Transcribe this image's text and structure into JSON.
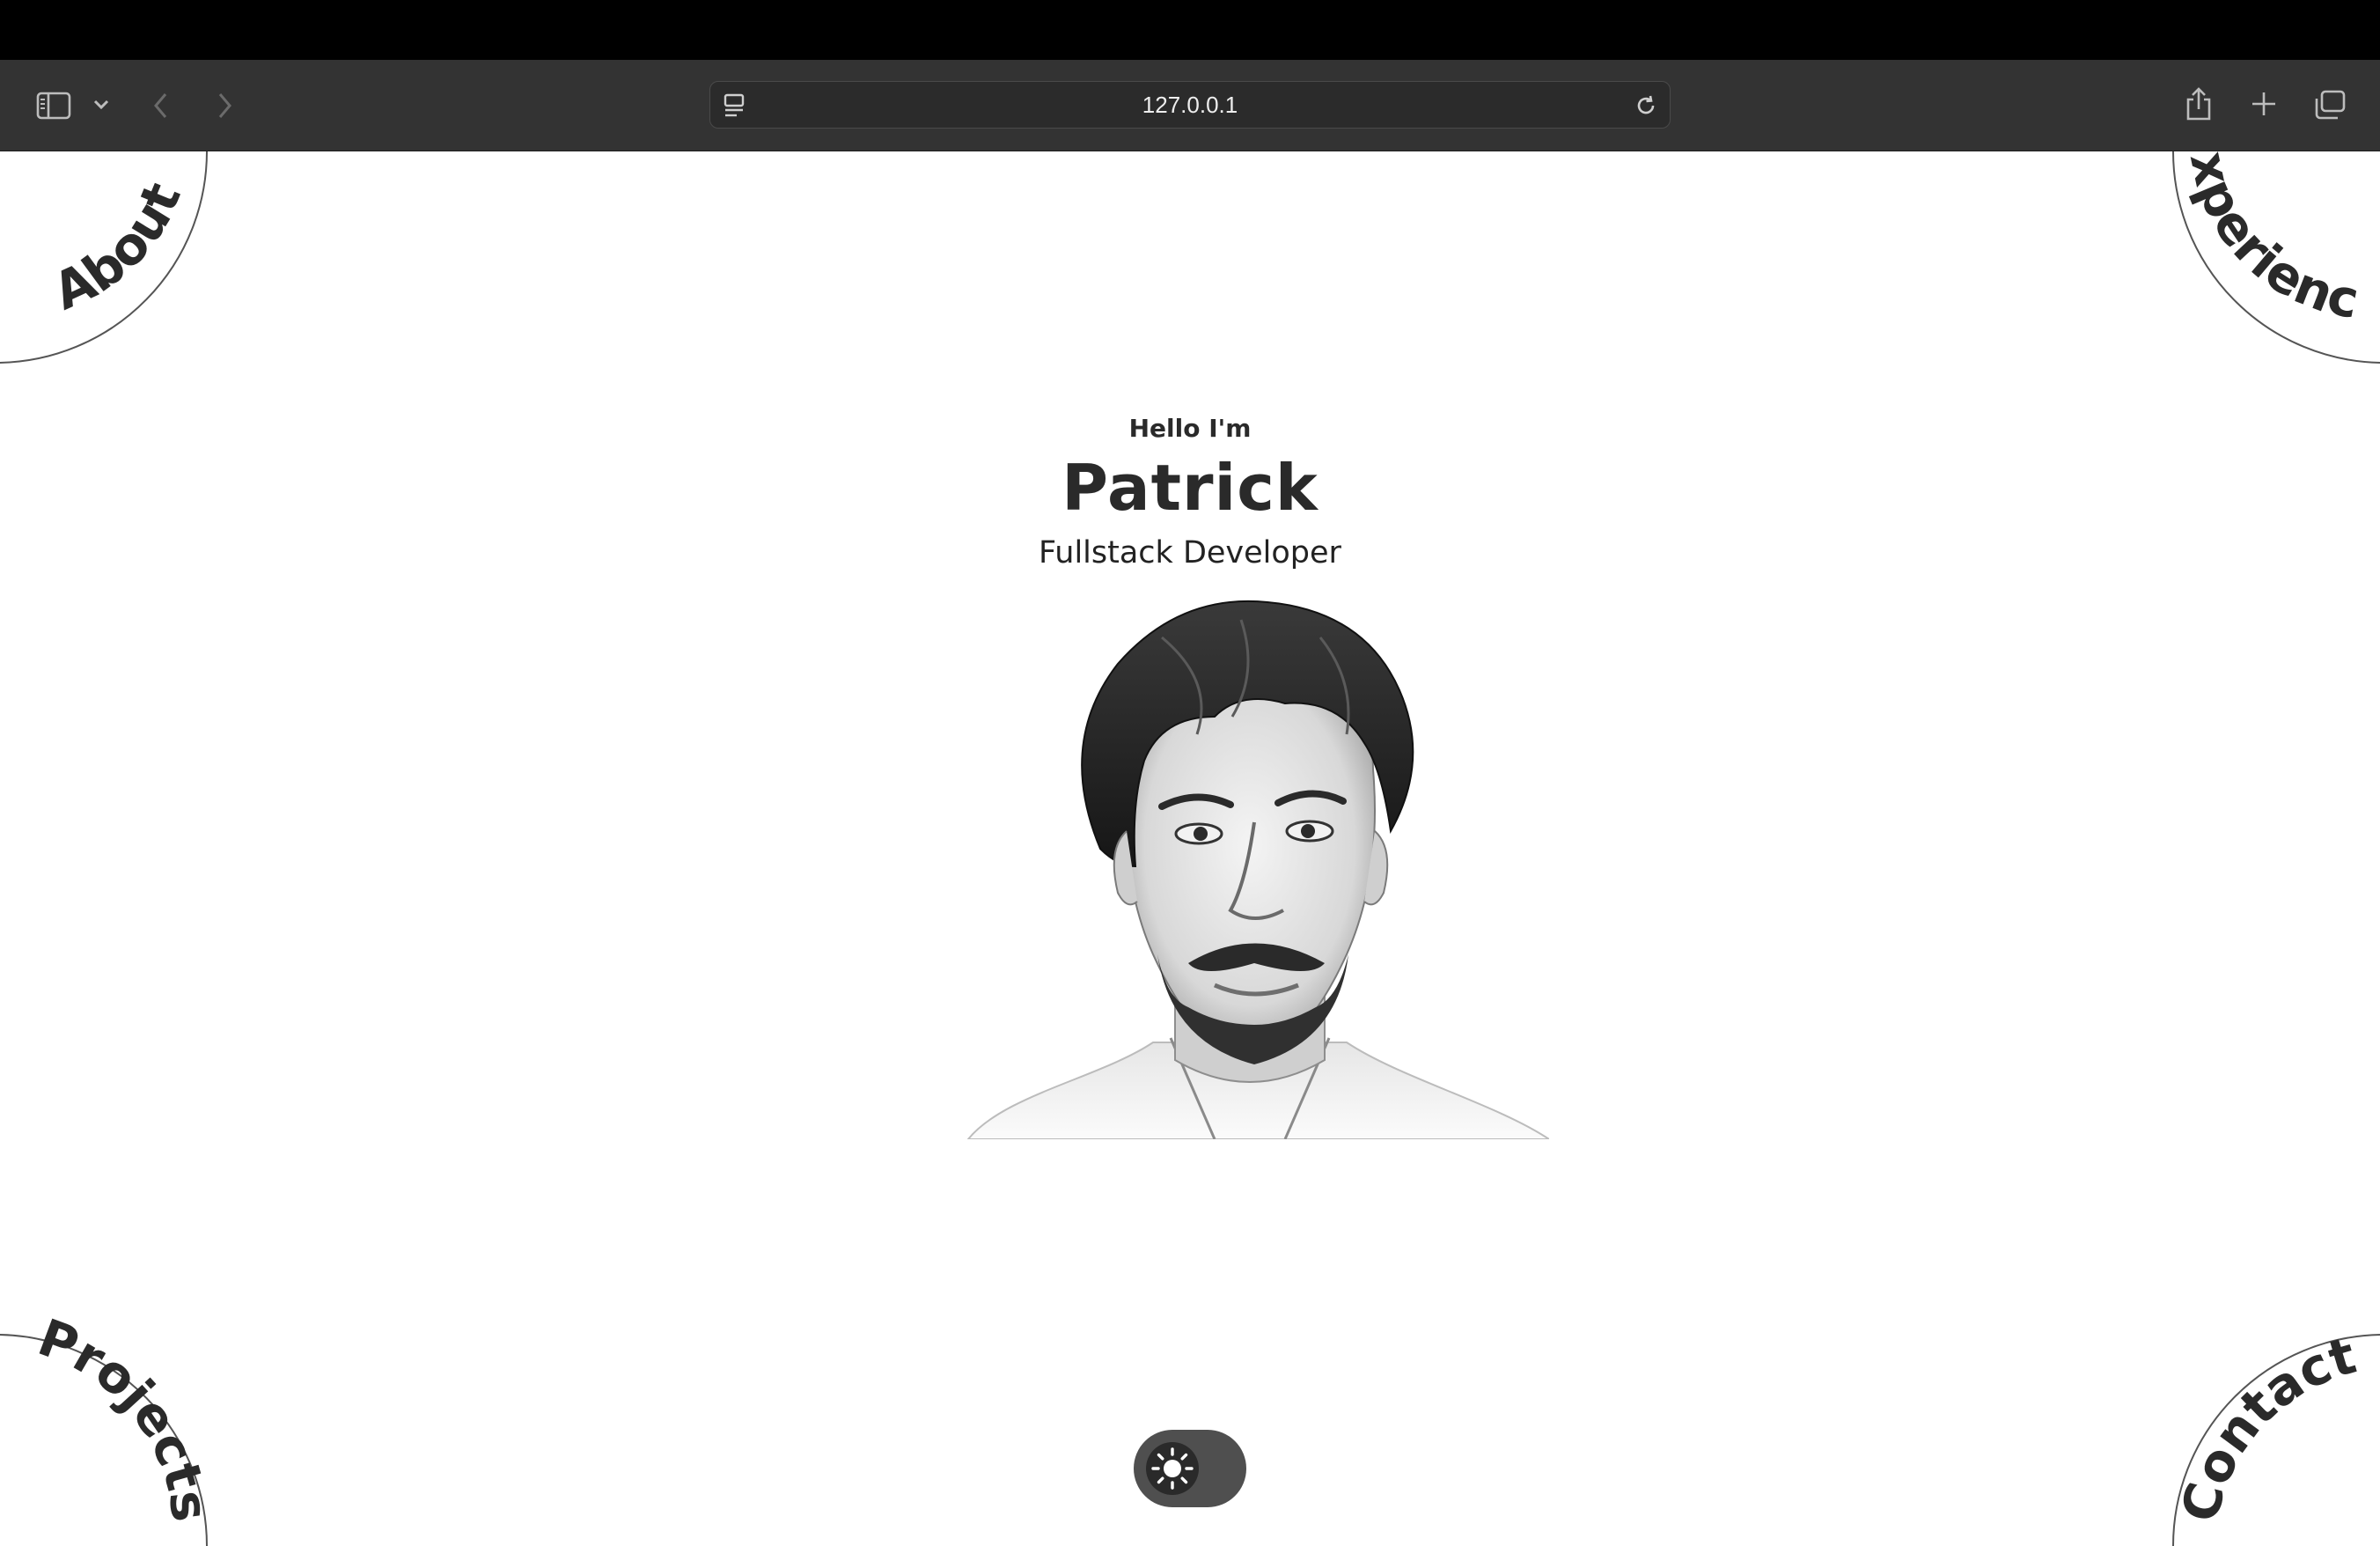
{
  "browser": {
    "url": "127.0.0.1"
  },
  "nav": {
    "about": "About",
    "experience": "Experience",
    "projects": "Projects",
    "contact": "Contact"
  },
  "hero": {
    "greeting": "Hello I'm",
    "name": "Patrick",
    "role": "Fullstack Developer"
  },
  "theme_toggle": {
    "mode": "light",
    "icon": "sun-icon"
  },
  "colors": {
    "text": "#2a2a2a",
    "toolbar": "#333333",
    "background": "#ffffff"
  }
}
